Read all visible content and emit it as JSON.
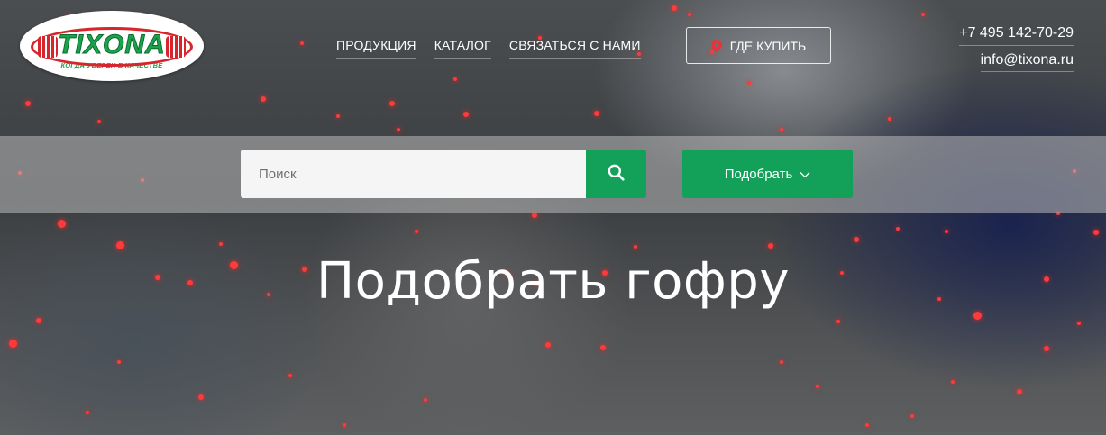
{
  "logo": {
    "brand": "TIXONA",
    "tagline": "КОГДА УВЕРЕН В КАЧЕСТВЕ"
  },
  "nav": {
    "items": [
      {
        "label": "ПРОДУКЦИЯ"
      },
      {
        "label": "КАТАЛОГ"
      },
      {
        "label": "СВЯЗАТЬСЯ С НАМИ"
      }
    ]
  },
  "where_to_buy": {
    "label": "ГДЕ КУПИТЬ",
    "icon": "map-pin-icon"
  },
  "contacts": {
    "phone": "+7 495 142-70-29",
    "email": "info@tixona.ru"
  },
  "search": {
    "placeholder": "Поиск",
    "value": "",
    "icon": "search-icon"
  },
  "pick_button": {
    "label": "Подобрать",
    "icon": "chevron-down-icon"
  },
  "hero": {
    "title": "Подобрать гофру"
  },
  "colors": {
    "accent": "#13a15a",
    "brand_red": "#d7262b",
    "brand_green": "#1aa34a",
    "pin_red": "#e8333a"
  }
}
